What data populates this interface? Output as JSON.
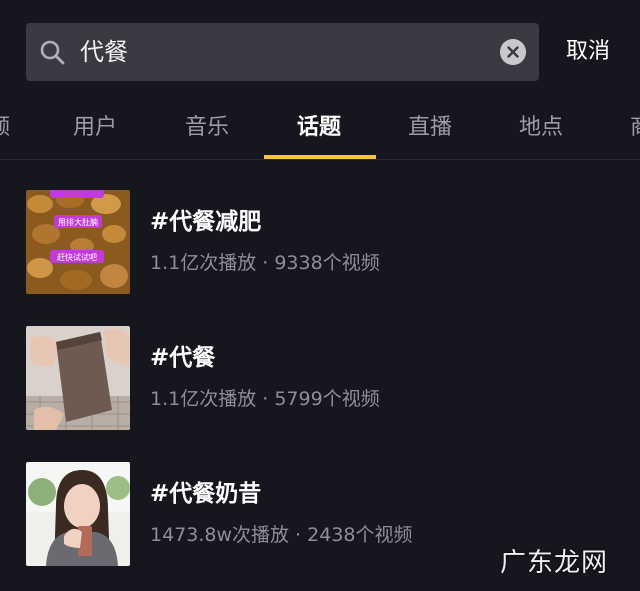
{
  "search": {
    "query": "代餐",
    "cancel_label": "取消"
  },
  "tabs": [
    {
      "label": "频"
    },
    {
      "label": "用户"
    },
    {
      "label": "音乐"
    },
    {
      "label": "话题",
      "active": true
    },
    {
      "label": "直播"
    },
    {
      "label": "地点"
    },
    {
      "label": "商"
    }
  ],
  "results": [
    {
      "title": "#代餐减肥",
      "meta": "1.1亿次播放 · 9338个视频",
      "thumb_captions": [
        "用排大肚腩",
        "赶快试试吧"
      ]
    },
    {
      "title": "#代餐",
      "meta": "1.1亿次播放 · 5799个视频"
    },
    {
      "title": "#代餐奶昔",
      "meta": "1473.8w次播放 · 2438个视频"
    }
  ],
  "watermark": "广东龙网",
  "colors": {
    "background": "#16161e",
    "search_box": "#3a3a42",
    "tab_indicator": "#f5c542",
    "meta_text": "#8e8e96"
  }
}
